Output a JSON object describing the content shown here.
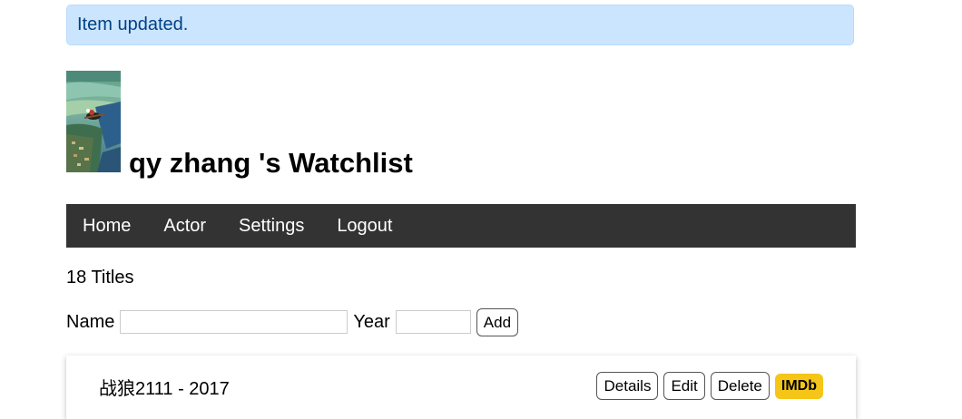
{
  "flash": {
    "message": "Item updated."
  },
  "header": {
    "avatar_icon": "avatar-image",
    "title": "qy zhang 's Watchlist"
  },
  "nav": {
    "items": [
      "Home",
      "Actor",
      "Settings",
      "Logout"
    ]
  },
  "summary": {
    "count_text": "18 Titles"
  },
  "add_form": {
    "name_label": "Name",
    "name_value": "",
    "year_label": "Year",
    "year_value": "",
    "submit_label": "Add"
  },
  "movies": [
    {
      "title_text": "战狼2111 - 2017",
      "details_label": "Details",
      "edit_label": "Edit",
      "delete_label": "Delete",
      "imdb_label": "IMDb"
    }
  ],
  "colors": {
    "flash_bg": "#cce5ff",
    "flash_text": "#004085",
    "nav_bg": "#333333",
    "imdb_bg": "#f5c518"
  }
}
